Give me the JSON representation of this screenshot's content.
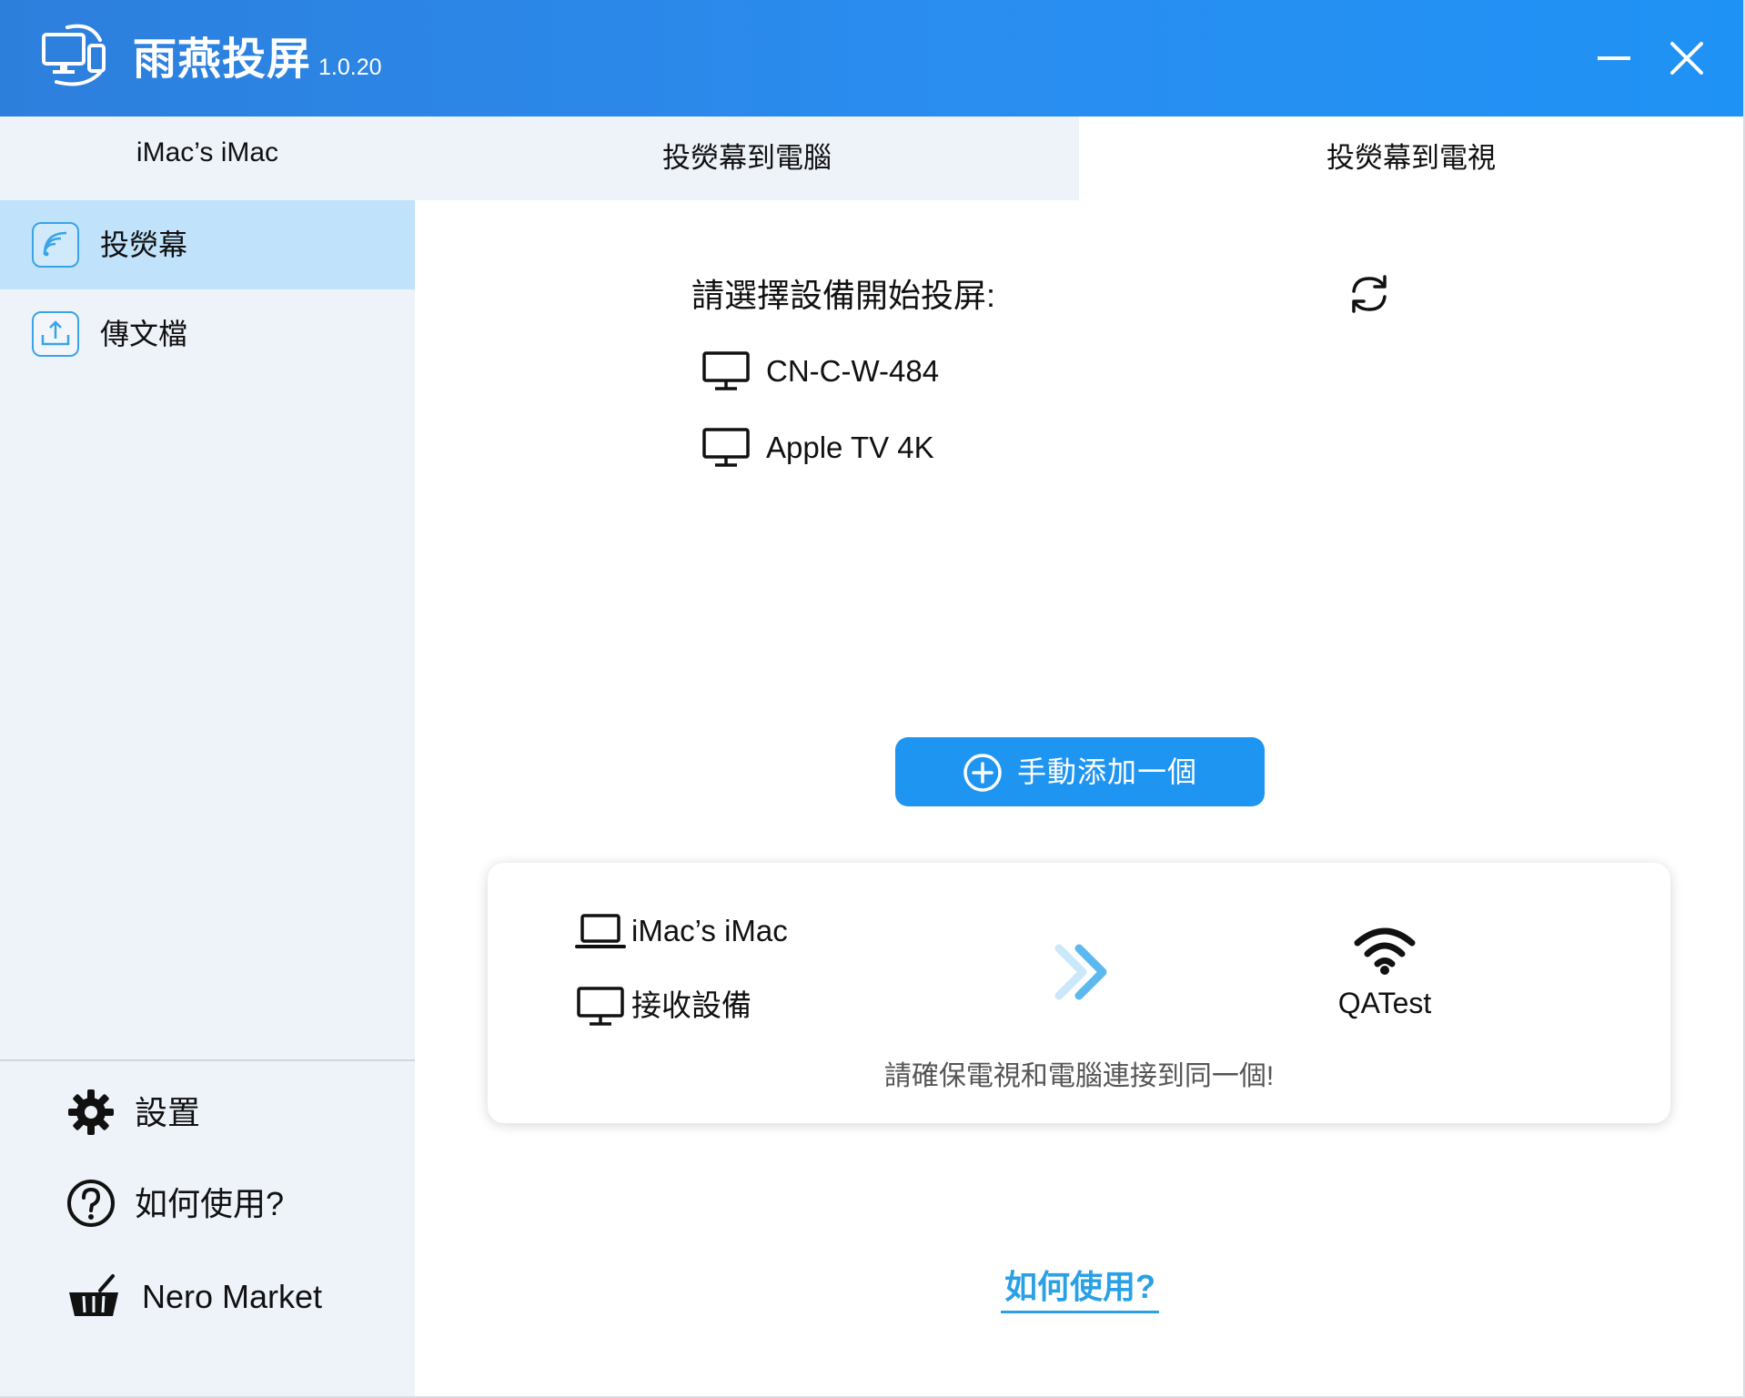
{
  "window": {
    "app_title": "雨燕投屏",
    "version": "1.0.20",
    "minimize_icon": "minimize-icon",
    "close_icon": "close-icon"
  },
  "sidebar": {
    "device_name": "iMac’s iMac",
    "items": [
      {
        "label": "投熒幕",
        "icon": "cast-icon",
        "active": true
      },
      {
        "label": "傳文檔",
        "icon": "upload-file-icon",
        "active": false
      }
    ],
    "bottom": [
      {
        "label": "設置",
        "icon": "gear-icon"
      },
      {
        "label": "如何使用?",
        "icon": "help-icon"
      },
      {
        "label": "Nero Market",
        "icon": "basket-icon"
      }
    ]
  },
  "tabs": [
    {
      "label": "投熒幕到電腦",
      "active": false
    },
    {
      "label": "投熒幕到電視",
      "active": true
    }
  ],
  "main": {
    "choose_label": "請選擇設備開始投屏:",
    "refresh_icon": "refresh-icon",
    "devices": [
      {
        "name": "CN-C-W-484",
        "icon": "monitor-icon"
      },
      {
        "name": "Apple TV 4K",
        "icon": "monitor-icon"
      }
    ],
    "add_button_label": "手動添加一個",
    "add_icon": "plus-circle-icon"
  },
  "info_card": {
    "source_name": "iMac’s iMac",
    "receiver_label": "接收設備",
    "wifi_name": "QATest",
    "note": "請確保電視和電腦連接到同一個!"
  },
  "footer": {
    "howto_link": "如何使用?"
  },
  "colors": {
    "titlebar": "#2a8df0",
    "accent": "#1f95f2",
    "sidebar_bg": "#eef3fa",
    "active_item_bg": "#c0e3fb",
    "link": "#2aa0e6"
  }
}
